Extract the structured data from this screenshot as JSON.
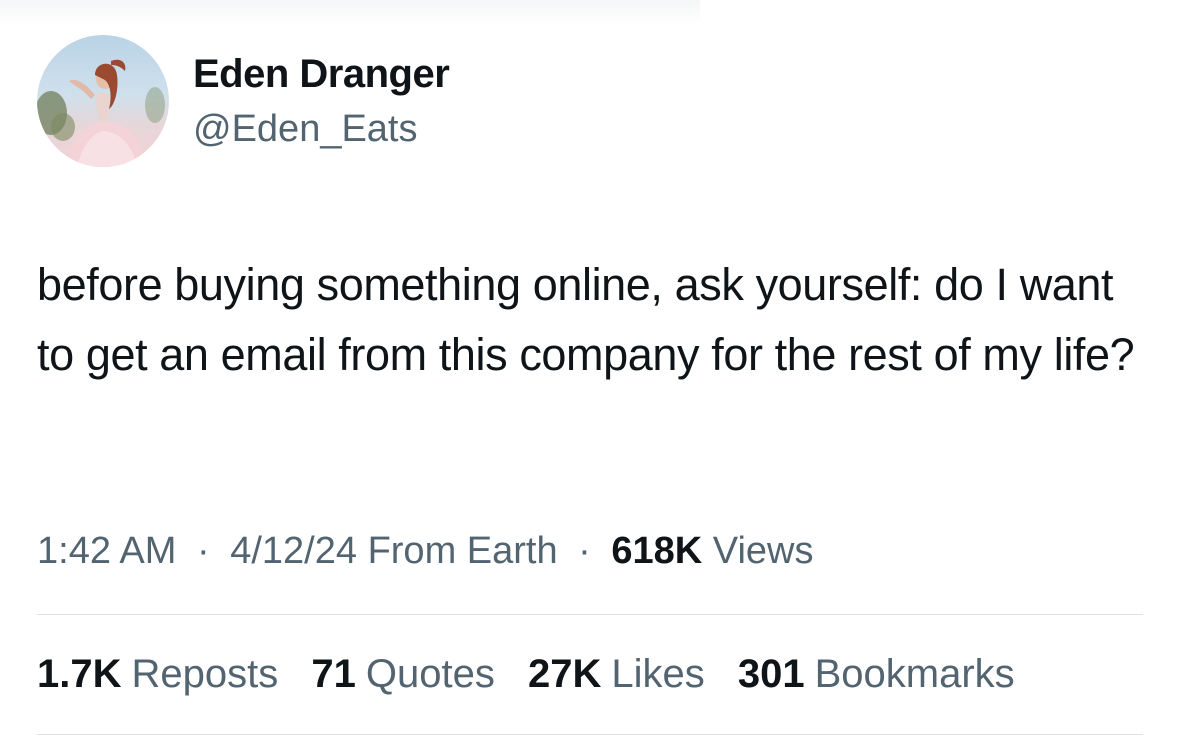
{
  "user": {
    "display_name": "Eden Dranger",
    "handle": "@Eden_Eats"
  },
  "tweet": {
    "text": "before buying something online, ask yourself: do I want to get an email from this company for the rest of my life?"
  },
  "meta": {
    "time": "1:42 AM",
    "separator": "·",
    "date": "4/12/24",
    "location": "From Earth",
    "views_count": "618K",
    "views_label": "Views"
  },
  "stats": {
    "reposts_count": "1.7K",
    "reposts_label": "Reposts",
    "quotes_count": "71",
    "quotes_label": "Quotes",
    "likes_count": "27K",
    "likes_label": "Likes",
    "bookmarks_count": "301",
    "bookmarks_label": "Bookmarks"
  },
  "colors": {
    "text_primary": "#0f1419",
    "text_secondary": "#536471",
    "divider": "#dfe3e6"
  }
}
